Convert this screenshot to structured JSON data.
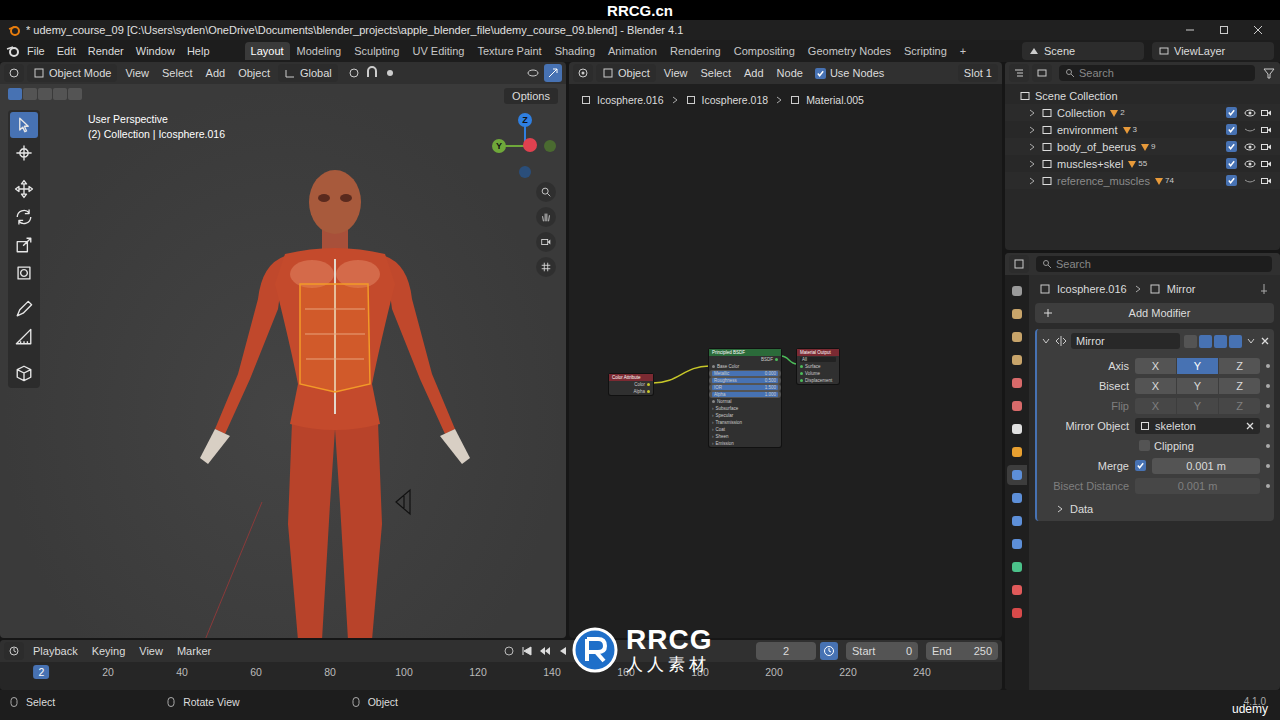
{
  "watermark": {
    "site": "RRCG.cn",
    "logo": "RRCG",
    "logo_cn": "人人素材",
    "course": "udemy"
  },
  "window": {
    "title": "* udemy_course_09 [C:\\Users\\syden\\OneDrive\\Documents\\blender_projects\\apple_blender_file\\udemy_course_09.blend] - Blender 4.1"
  },
  "menu": [
    "File",
    "Edit",
    "Render",
    "Window",
    "Help"
  ],
  "workspaces": [
    {
      "label": "Layout",
      "selected": true
    },
    {
      "label": "Modeling",
      "selected": false
    },
    {
      "label": "Sculpting",
      "selected": false
    },
    {
      "label": "UV Editing",
      "selected": false
    },
    {
      "label": "Texture Paint",
      "selected": false
    },
    {
      "label": "Shading",
      "selected": false
    },
    {
      "label": "Animation",
      "selected": false
    },
    {
      "label": "Rendering",
      "selected": false
    },
    {
      "label": "Compositing",
      "selected": false
    },
    {
      "label": "Geometry Nodes",
      "selected": false
    },
    {
      "label": "Scripting",
      "selected": false
    }
  ],
  "add_workspace": "+",
  "scene": "Scene",
  "view_layer": "ViewLayer",
  "viewport": {
    "mode": "Object Mode",
    "menu": [
      "View",
      "Select",
      "Add",
      "Object"
    ],
    "orientation": "Global",
    "options": "Options",
    "perspective": "User Perspective",
    "context": "(2) Collection | Icosphere.016",
    "select_modes": [
      {
        "selected": true
      },
      {
        "selected": false
      },
      {
        "selected": false
      },
      {
        "selected": false
      },
      {
        "selected": false
      }
    ],
    "tools": [
      {
        "kind": "select",
        "selected": true
      },
      {
        "kind": "cursor",
        "selected": false
      },
      {
        "kind": "move",
        "selected": false
      },
      {
        "kind": "rotate",
        "selected": false
      },
      {
        "kind": "scale",
        "selected": false
      },
      {
        "kind": "transform",
        "selected": false
      },
      {
        "kind": "annotate",
        "selected": false
      },
      {
        "kind": "measure",
        "selected": false
      },
      {
        "kind": "add",
        "selected": false
      }
    ],
    "gizmo": [
      {
        "label": "Z",
        "color": "#2f7fe0"
      },
      {
        "label": "Y",
        "color": "#6fa83a"
      },
      {
        "label": "",
        "color": "#e0414f"
      }
    ]
  },
  "node_editor": {
    "mode": "Object",
    "menu": [
      "View",
      "Select",
      "Add",
      "Node"
    ],
    "use_nodes": {
      "label": "Use Nodes",
      "checked": true
    },
    "slot": "Slot 1",
    "breadcrumb": [
      "Icosphere.016",
      "Icosphere.018",
      "Material.005"
    ],
    "color_attribute": {
      "title": "Color Attribute",
      "outputs": [
        "Color",
        "Alpha"
      ]
    },
    "principled": {
      "title": "Principled BSDF",
      "output": "BSDF",
      "rows": [
        {
          "label": "Base Color",
          "kind": "socket"
        },
        {
          "label": "Metallic",
          "kind": "field",
          "value": "0.000"
        },
        {
          "label": "Roughness",
          "kind": "field",
          "value": "0.500"
        },
        {
          "label": "IOR",
          "kind": "field",
          "value": "1.500"
        },
        {
          "label": "Alpha",
          "kind": "field",
          "value": "1.000"
        },
        {
          "label": "Normal",
          "kind": "socket"
        },
        {
          "label": "Subsurface",
          "kind": "panel"
        },
        {
          "label": "Specular",
          "kind": "panel"
        },
        {
          "label": "Transmission",
          "kind": "panel"
        },
        {
          "label": "Coat",
          "kind": "panel"
        },
        {
          "label": "Sheen",
          "kind": "panel"
        },
        {
          "label": "Emission",
          "kind": "panel"
        }
      ]
    },
    "output": {
      "title": "Material Output",
      "target": "All",
      "inputs": [
        "Surface",
        "Volume",
        "Displacement"
      ]
    }
  },
  "outliner": {
    "search": "Search",
    "root": "Scene Collection",
    "collections": [
      {
        "name": "Collection",
        "count": "2",
        "checked": true,
        "visible": true,
        "disabled": false
      },
      {
        "name": "environment",
        "count": "3",
        "checked": true,
        "visible": false,
        "disabled": false
      },
      {
        "name": "body_of_beerus",
        "count": "9",
        "checked": true,
        "visible": true,
        "disabled": false
      },
      {
        "name": "muscles+skel",
        "count": "55",
        "checked": true,
        "visible": true,
        "disabled": false
      },
      {
        "name": "reference_muscles",
        "count": "74",
        "checked": true,
        "visible": false,
        "disabled": true
      }
    ]
  },
  "properties": {
    "search": "Search",
    "tabs": [
      {
        "color": "#9a9a9a",
        "selected": false
      },
      {
        "color": "#c8a46a",
        "selected": false
      },
      {
        "color": "#c8a46a",
        "selected": false
      },
      {
        "color": "#c8a46a",
        "selected": false
      },
      {
        "color": "#d86a6a",
        "selected": false
      },
      {
        "color": "#d86a6a",
        "selected": false
      },
      {
        "color": "#e0e0e0",
        "selected": false
      },
      {
        "color": "#e8a030",
        "selected": false
      },
      {
        "color": "#5d8fd8",
        "selected": true
      },
      {
        "color": "#5d8fd8",
        "selected": false
      },
      {
        "color": "#5d8fd8",
        "selected": false
      },
      {
        "color": "#5d8fd8",
        "selected": false
      },
      {
        "color": "#4bc28a",
        "selected": false
      },
      {
        "color": "#e05a5a",
        "selected": false
      },
      {
        "color": "#d84a4a",
        "selected": false
      }
    ],
    "path": [
      "Icosphere.016",
      "Mirror"
    ],
    "add_modifier": "Add Modifier",
    "modifier": {
      "name": "Mirror",
      "expanded": true,
      "rows": [
        {
          "label": "Axis",
          "kind": "toggles",
          "disabled": false,
          "options": [
            {
              "label": "X",
              "selected": false
            },
            {
              "label": "Y",
              "selected": true
            },
            {
              "label": "Z",
              "selected": false
            }
          ]
        },
        {
          "label": "Bisect",
          "kind": "toggles",
          "disabled": false,
          "options": [
            {
              "label": "X",
              "selected": false
            },
            {
              "label": "Y",
              "selected": false
            },
            {
              "label": "Z",
              "selected": false
            }
          ]
        },
        {
          "label": "Flip",
          "kind": "toggles",
          "disabled": true,
          "options": [
            {
              "label": "X",
              "selected": false
            },
            {
              "label": "Y",
              "selected": false
            },
            {
              "label": "Z",
              "selected": false
            }
          ]
        },
        {
          "label": "Mirror Object",
          "kind": "object",
          "disabled": false,
          "value": "skeleton"
        },
        {
          "label": "",
          "kind": "checkbox",
          "disabled": false,
          "text": "Clipping",
          "checked": false
        },
        {
          "label": "Merge",
          "kind": "checkvalue",
          "disabled": false,
          "checked": true,
          "value": "0.001 m"
        },
        {
          "label": "Bisect Distance",
          "kind": "value",
          "disabled": true,
          "value": "0.001 m"
        }
      ],
      "subpanel": {
        "label": "Data",
        "expanded": false
      }
    }
  },
  "timeline": {
    "menus": [
      "Playback",
      "Keying",
      "View",
      "Marker"
    ],
    "frame": "2",
    "start_label": "Start",
    "start": "0",
    "end_label": "End",
    "end": "250",
    "current": "2",
    "ticks": [
      "20",
      "40",
      "60",
      "80",
      "100",
      "120",
      "140",
      "160",
      "180",
      "200",
      "220",
      "240"
    ]
  },
  "status": {
    "items": [
      "Select",
      "Rotate View",
      "Object"
    ],
    "version": "4.1.0"
  }
}
